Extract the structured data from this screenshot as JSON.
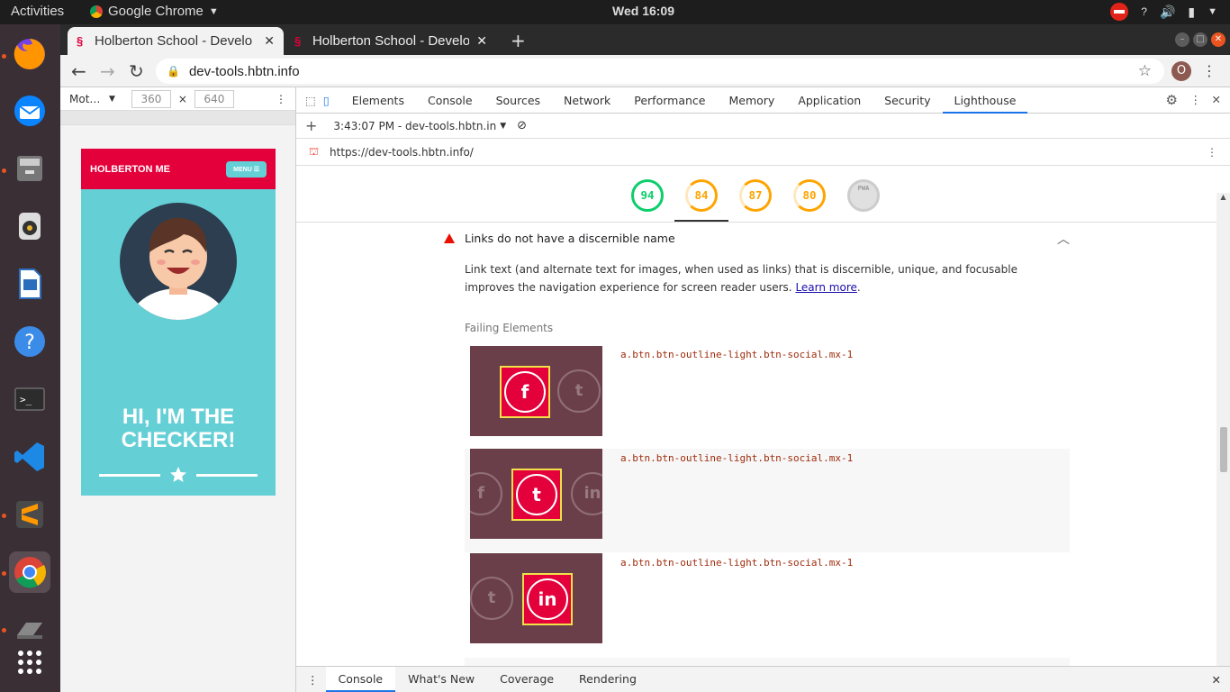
{
  "os": {
    "activities": "Activities",
    "app_name": "Google Chrome",
    "clock": "Wed 16:09",
    "dock": [
      "firefox-icon",
      "thunderbird-icon",
      "files-icon",
      "rhythmbox-icon",
      "writer-icon",
      "help-icon",
      "terminal-icon",
      "vscode-icon",
      "sublime-icon",
      "chrome-icon",
      "scanner-icon",
      "apps-grid-icon"
    ]
  },
  "browser": {
    "tabs": [
      {
        "title": "Holberton School - Develo",
        "active": true
      },
      {
        "title": "Holberton School - Develo",
        "active": false
      }
    ],
    "url": "dev-tools.hbtn.info",
    "profile_initial": "O"
  },
  "device_toolbar": {
    "device": "Mot…",
    "width": "360",
    "height": "640",
    "times": "×"
  },
  "page": {
    "brand": "HOLBERTON ME",
    "menu_label": "MENU ☰",
    "headline_1": "HI, I'M THE",
    "headline_2": "CHECKER!"
  },
  "devtools": {
    "tabs": [
      "Elements",
      "Console",
      "Sources",
      "Network",
      "Performance",
      "Memory",
      "Application",
      "Security",
      "Lighthouse"
    ],
    "selected_tab": "Lighthouse",
    "report_selector": "3:43:07 PM - dev-tools.hbtn.in",
    "report_url": "https://dev-tools.hbtn.info/",
    "scores": [
      {
        "value": "94",
        "color": "#0cce6b"
      },
      {
        "value": "84",
        "color": "#ffa400"
      },
      {
        "value": "87",
        "color": "#ffa400"
      },
      {
        "value": "80",
        "color": "#ffa400"
      },
      {
        "value": "PWA",
        "color": "#cccccc"
      }
    ],
    "audit": {
      "title": "Links do not have a discernible name",
      "description": "Link text (and alternate text for images, when used as links) that is discernible, unique, and focusable improves the navigation experience for screen reader users.",
      "learn_more": "Learn more",
      "period": ".",
      "failing_label": "Failing Elements",
      "failing_elements": [
        {
          "selector": "a.btn.btn-outline-light.btn-social.mx-1",
          "icon": "facebook-icon"
        },
        {
          "selector": "a.btn.btn-outline-light.btn-social.mx-1",
          "icon": "twitter-icon"
        },
        {
          "selector": "a.btn.btn-outline-light.btn-social.mx-1",
          "icon": "linkedin-icon"
        }
      ]
    },
    "drawer_tabs": [
      "Console",
      "What's New",
      "Coverage",
      "Rendering"
    ],
    "drawer_selected": "Console"
  }
}
